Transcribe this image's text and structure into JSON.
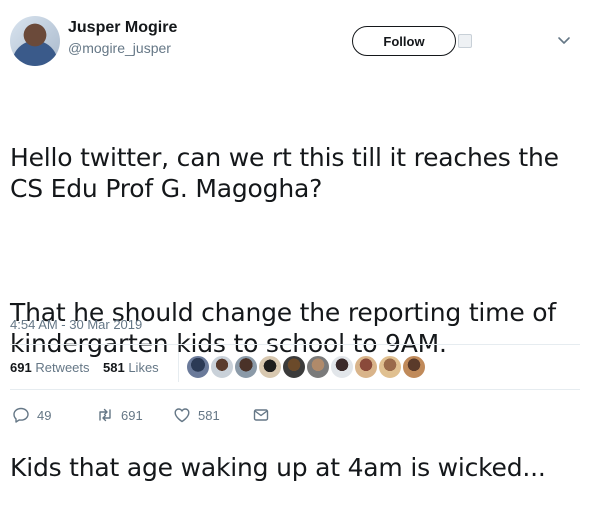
{
  "author": {
    "display_name": "Jusper Mogire",
    "handle": "@mogire_jusper"
  },
  "follow_button": {
    "label": "Follow"
  },
  "tweet": {
    "paragraphs": [
      "Hello twitter, can we rt this till it reaches the CS Edu Prof G. Magogha?",
      "That he should change the reporting time of kindergarten kids to school to 9AM.",
      "Kids that age waking up at 4am is wicked..."
    ],
    "timestamp": "4:54 AM - 30 Mar 2019"
  },
  "stats": {
    "retweets_count": "691",
    "retweets_label": "Retweets",
    "likes_count": "581",
    "likes_label": "Likes"
  },
  "actions": {
    "reply_count": "49",
    "retweet_count": "691",
    "like_count": "581"
  },
  "colors": {
    "text": "#14171a",
    "secondary": "#657786",
    "divider": "#e6ecf0"
  },
  "icons": [
    "chevron-down-icon",
    "reply-icon",
    "retweet-icon",
    "heart-icon",
    "dm-icon"
  ]
}
